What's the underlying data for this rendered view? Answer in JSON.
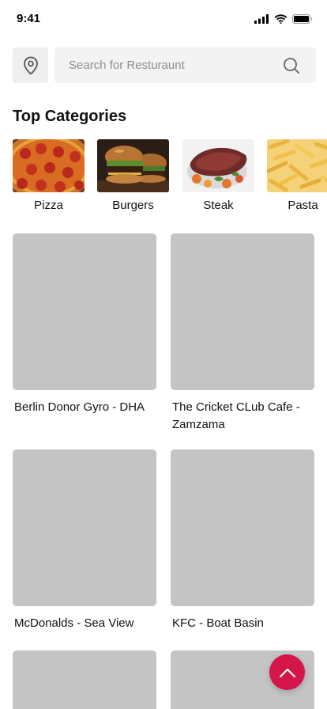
{
  "status_bar": {
    "time": "9:41"
  },
  "search": {
    "placeholder": "Search for Resturaunt"
  },
  "categories_section": {
    "title": "Top Categories",
    "items": [
      {
        "label": "Pizza"
      },
      {
        "label": "Burgers"
      },
      {
        "label": "Steak"
      },
      {
        "label": "Pasta"
      }
    ]
  },
  "restaurants": [
    {
      "name": "Berlin Donor Gyro - DHA"
    },
    {
      "name": "The Cricket CLub Cafe - Zamzama"
    },
    {
      "name": "McDonalds - Sea View"
    },
    {
      "name": "KFC - Boat Basin"
    },
    {
      "name": ""
    },
    {
      "name": ""
    }
  ],
  "colors": {
    "accent": "#d4164a",
    "placeholder_card": "#c4c4c4",
    "search_bg": "#f3f3f3"
  },
  "icons": {
    "location": "map-pin-icon",
    "search": "search-icon",
    "fab": "chevron-up-icon"
  }
}
